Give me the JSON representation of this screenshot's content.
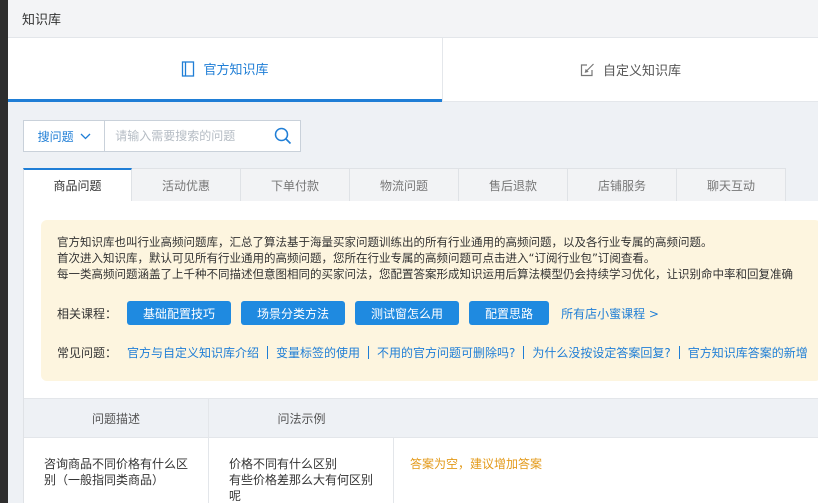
{
  "app": {
    "title": "知识库"
  },
  "main_tabs": [
    {
      "label": "官方知识库",
      "icon": "book-icon",
      "active": true
    },
    {
      "label": "自定义知识库",
      "icon": "edit-icon",
      "active": false
    }
  ],
  "search": {
    "type_label": "搜问题",
    "placeholder": "请输入需要搜索的问题",
    "value": ""
  },
  "category_tabs": [
    "商品问题",
    "活动优惠",
    "下单付款",
    "物流问题",
    "售后退款",
    "店铺服务",
    "聊天互动"
  ],
  "notice": {
    "lines": [
      "官方知识库也叫行业高频问题库，汇总了算法基于海量买家问题训练出的所有行业通用的高频问题，以及各行业专属的高频问题。",
      "首次进入知识库，默认可见所有行业通用的高频问题，您所在行业专属的高频问题可点击进入“订阅行业包”订阅查看。",
      "每一类高频问题涵盖了上千种不同描述但意图相同的买家问法，您配置答案形成知识运用后算法模型仍会持续学习优化，让识别命中率和回复准确"
    ],
    "courses_label": "相关课程：",
    "courses": [
      "基础配置技巧",
      "场景分类方法",
      "测试窗怎么用",
      "配置思路"
    ],
    "all_courses_link": "所有店小蜜课程 >",
    "faq_label": "常见问题：",
    "faqs": [
      "官方与自定义知识库介绍",
      "变量标签的使用",
      "不用的官方问题可删除吗?",
      "为什么没按设定答案回复?",
      "官方知识库答案的新增"
    ]
  },
  "table": {
    "headers": [
      "问题描述",
      "问法示例"
    ],
    "rows": [
      {
        "description": "咨询商品不同价格有什么区别（一般指同类商品）",
        "examples": "价格不同有什么区别\n有些价格差那么大有何区别呢",
        "answer": "答案为空，建议增加答案"
      }
    ]
  },
  "colors": {
    "accent": "#1f7ed6",
    "notice_bg": "#fdf5df",
    "warning_text": "#e39a1a",
    "button_bg": "#1f8ae0"
  }
}
